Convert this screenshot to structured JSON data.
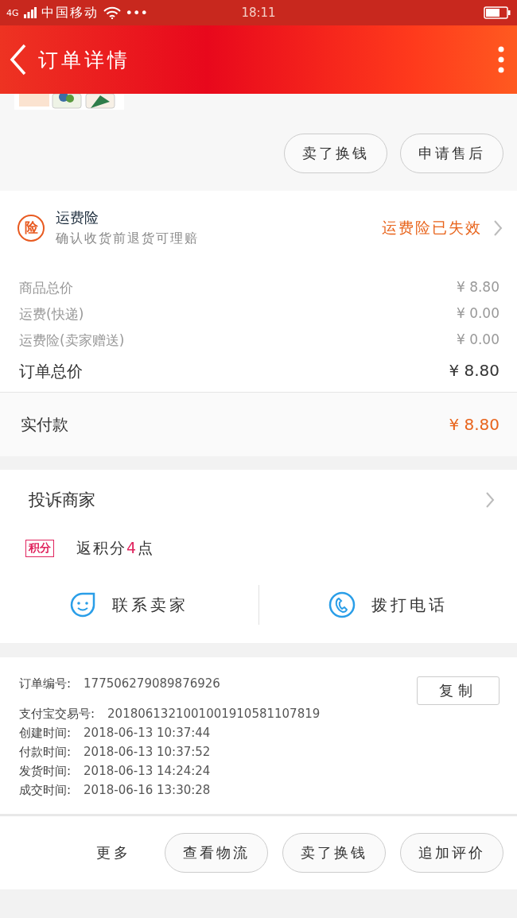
{
  "status_bar": {
    "network": "4G",
    "carrier": "中国移动",
    "extra": "•••",
    "time": "18:11"
  },
  "header": {
    "title": "订单详情"
  },
  "top_actions": [
    "卖了换钱",
    "申请售后"
  ],
  "insurance": {
    "badge": "险",
    "title": "运费险",
    "subtitle": "确认收货前退货可理赔",
    "status": "运费险已失效"
  },
  "price_rows": [
    {
      "label": "商品总价",
      "value": "¥ 8.80",
      "kind": "minor"
    },
    {
      "label": "运费(快递)",
      "value": "¥ 0.00",
      "kind": "minor"
    },
    {
      "label": "运费险(卖家赠送)",
      "value": "¥ 0.00",
      "kind": "minor"
    },
    {
      "label": "订单总价",
      "value": "¥ 8.80",
      "kind": "total"
    }
  ],
  "paid": {
    "label": "实付款",
    "value": "¥ 8.80"
  },
  "complaint": {
    "label": "投诉商家"
  },
  "points": {
    "badge": "积分",
    "prefix": "返积分",
    "amount": "4",
    "suffix": "点"
  },
  "contacts": [
    {
      "label": "联系卖家",
      "kind": "chat"
    },
    {
      "label": "拨打电话",
      "kind": "phone"
    }
  ],
  "order_info": {
    "copy_button": "复制",
    "fields": [
      {
        "label": "订单编号:",
        "value": "177506279089876926"
      },
      {
        "label": "支付宝交易号:",
        "value": "2018061321001001910581107819"
      },
      {
        "label": "创建时间:",
        "value": "2018-06-13 10:37:44"
      },
      {
        "label": "付款时间:",
        "value": "2018-06-13 10:37:52"
      },
      {
        "label": "发货时间:",
        "value": "2018-06-13 14:24:24"
      },
      {
        "label": "成交时间:",
        "value": "2018-06-16 13:30:28"
      }
    ]
  },
  "bottom_bar": {
    "more": "更多",
    "buttons": [
      "查看物流",
      "卖了换钱",
      "追加评价"
    ]
  }
}
